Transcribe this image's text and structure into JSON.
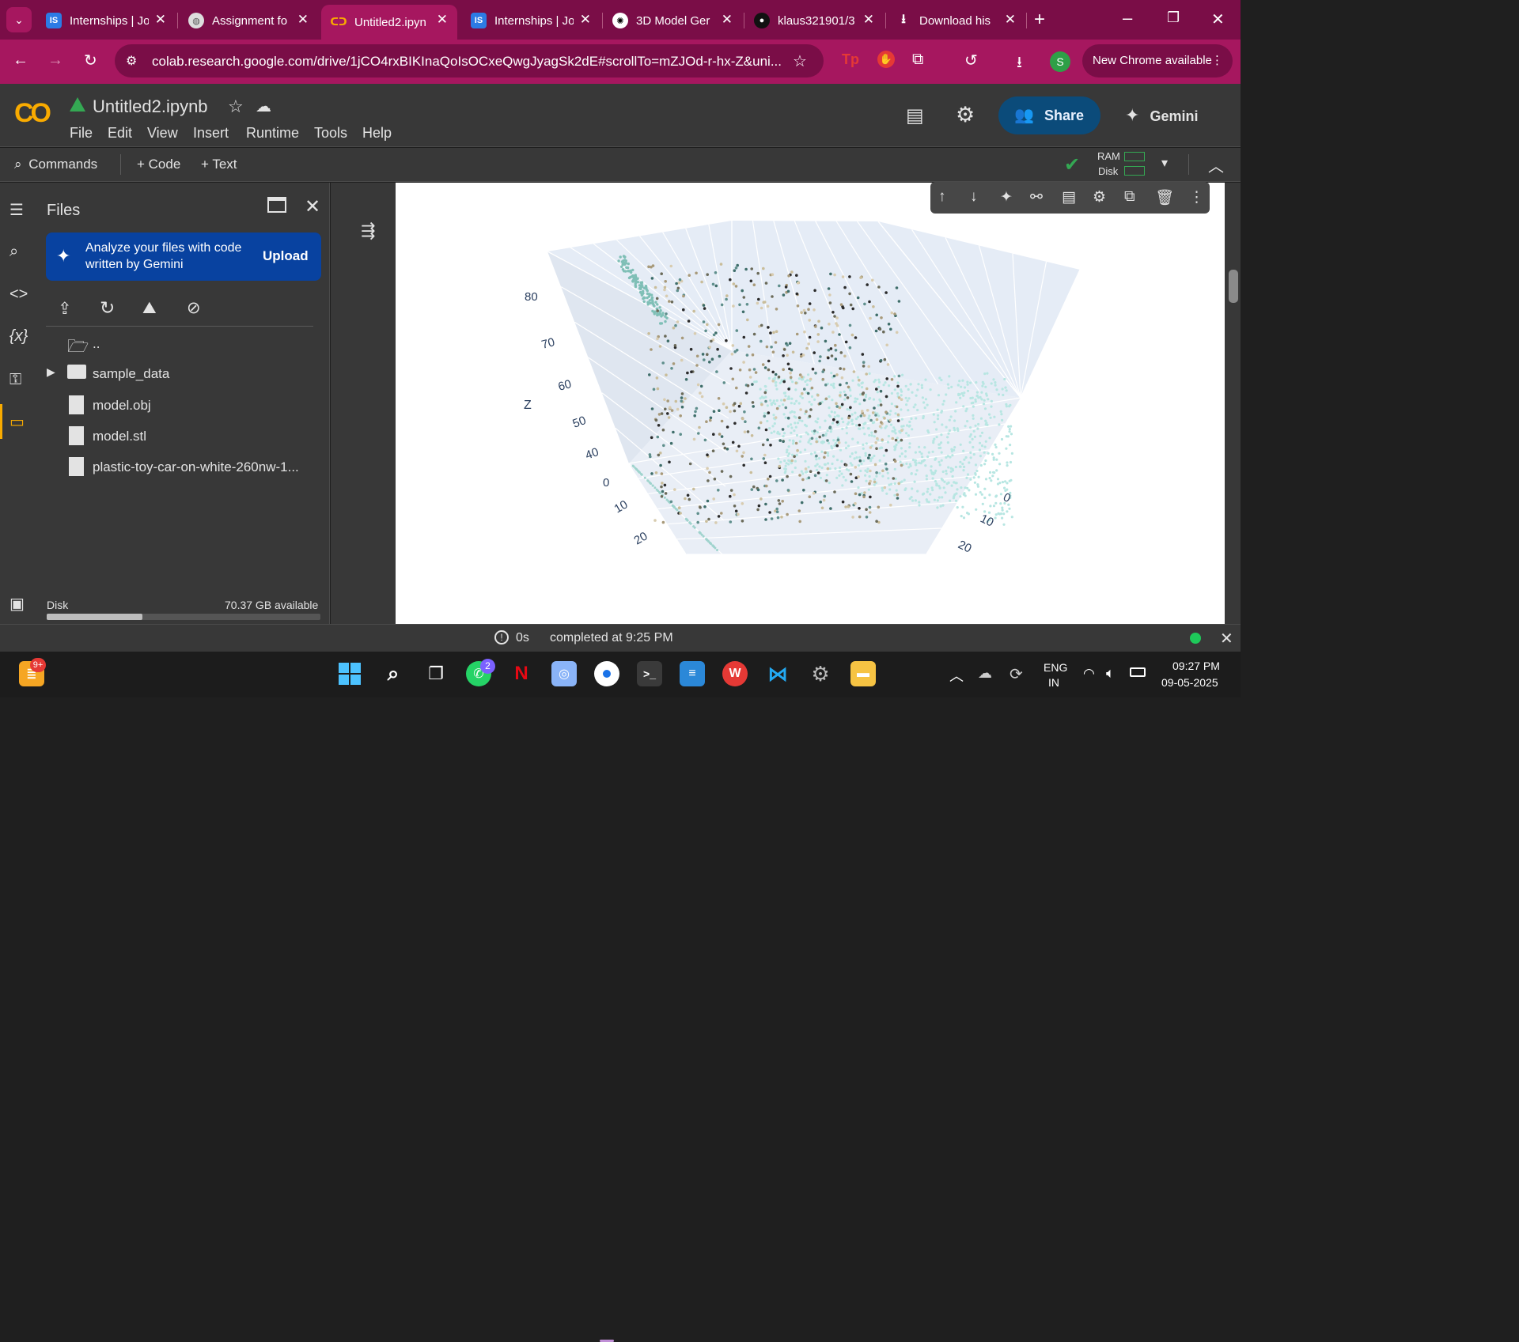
{
  "browser": {
    "tabs": [
      {
        "title": "Internships | Jo",
        "icon": "IS",
        "active": false
      },
      {
        "title": "Assignment fo",
        "icon": "globe-icon",
        "active": false
      },
      {
        "title": "Untitled2.ipyn",
        "icon": "CO",
        "active": true
      },
      {
        "title": "Internships | Jo",
        "icon": "IS",
        "active": false
      },
      {
        "title": "3D Model Ger",
        "icon": "openai-icon",
        "active": false
      },
      {
        "title": "klaus321901/3",
        "icon": "github-icon",
        "active": false
      },
      {
        "title": "Download his",
        "icon": "download-icon",
        "active": false
      }
    ],
    "url": "colab.research.google.com/drive/1jCO4rxBIKInaQoIsOCxeQwgJyagSk2dE#scrollTo=mZJOd-r-hx-Z&uni...",
    "profile_initial": "S",
    "new_chrome": "New Chrome available",
    "accent": "#a6175f"
  },
  "colab": {
    "logo": "CO",
    "notebook_title": "Untitled2.ipynb",
    "menus": [
      "File",
      "Edit",
      "View",
      "Insert",
      "Runtime",
      "Tools",
      "Help"
    ],
    "share": "Share",
    "gemini": "Gemini",
    "commands": "Commands",
    "add_code": "+ Code",
    "add_text": "+ Text",
    "ram": "RAM",
    "disk": "Disk"
  },
  "files_panel": {
    "title": "Files",
    "gemini_card": "Analyze your files with code written by Gemini",
    "upload": "Upload",
    "items": [
      {
        "name": "..",
        "type": "folder-up"
      },
      {
        "name": "sample_data",
        "type": "folder"
      },
      {
        "name": "model.obj",
        "type": "file"
      },
      {
        "name": "model.stl",
        "type": "file"
      },
      {
        "name": "plastic-toy-car-on-white-260nw-1...",
        "type": "file"
      }
    ],
    "disk_label": "Disk",
    "disk_available": "70.37 GB available",
    "disk_used_fraction": 0.35
  },
  "plot": {
    "z_label": "Z",
    "z_ticks": [
      "80",
      "70",
      "60",
      "50",
      "40"
    ],
    "x_ticks": [
      "0",
      "10",
      "20"
    ],
    "y_ticks": [
      "0",
      "10",
      "20"
    ]
  },
  "status": {
    "elapsed": "0s",
    "message": "completed at 9:25 PM"
  },
  "taskbar": {
    "notification_badge": "9+",
    "whatsapp_badge": "2",
    "language": "ENG",
    "region": "IN",
    "time": "09:27 PM",
    "date": "09-05-2025"
  }
}
